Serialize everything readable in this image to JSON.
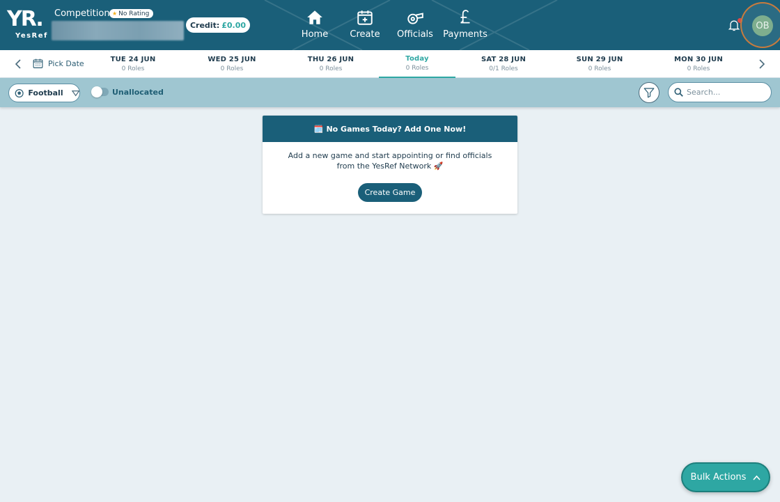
{
  "header": {
    "logo_text": "YR.",
    "logo_sub": "YesRef",
    "competition_label": "Competition:",
    "rating_badge": "No Rating",
    "credit_label": "Credit:",
    "credit_amount": "£0.00",
    "nav": [
      {
        "label": "Home",
        "icon": "home-icon"
      },
      {
        "label": "Create",
        "icon": "calendar-plus-icon"
      },
      {
        "label": "Officials",
        "icon": "whistle-icon"
      },
      {
        "label": "Payments",
        "icon": "pound-icon"
      }
    ],
    "avatar_initials": "OB"
  },
  "datebar": {
    "pick_date_label": "Pick Date",
    "days": [
      {
        "label": "TUE 24 JUN",
        "roles": "0 Roles"
      },
      {
        "label": "WED 25 JUN",
        "roles": "0 Roles"
      },
      {
        "label": "THU 26 JUN",
        "roles": "0 Roles"
      },
      {
        "label": "Today",
        "roles": "0 Roles",
        "active": true
      },
      {
        "label": "SAT 28 JUN",
        "roles": "0/1 Roles"
      },
      {
        "label": "SUN 29 JUN",
        "roles": "0 Roles"
      },
      {
        "label": "MON 30 JUN",
        "roles": "0 Roles"
      }
    ]
  },
  "filters": {
    "sport": "Football",
    "unallocated_label": "Unallocated",
    "search_placeholder": "Search..."
  },
  "empty_state": {
    "title": "No Games Today? Add One Now!",
    "line1": "Add a new game and start appointing or find officials",
    "line2": "from the YesRef Network 🚀",
    "button": "Create Game"
  },
  "bulk_actions": {
    "label": "Bulk Actions"
  },
  "colors": {
    "primary": "#1a5f79",
    "accent": "#2ea7a3",
    "filterbar": "#9fc6d1",
    "background": "#e9f0f4"
  }
}
